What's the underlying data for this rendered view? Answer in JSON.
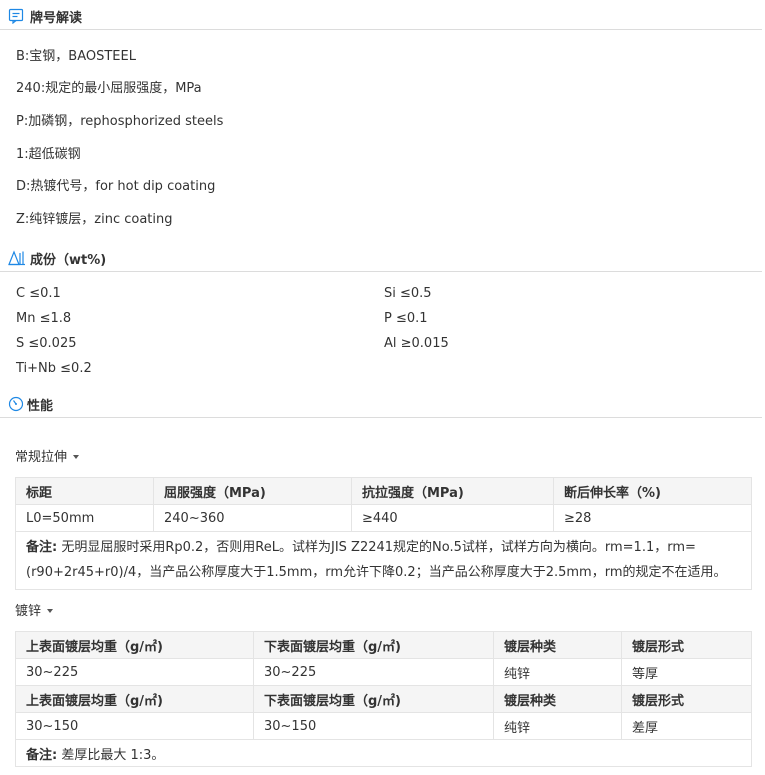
{
  "grade": {
    "title": "牌号解读",
    "lines": [
      "B:宝钢，BAOSTEEL",
      "240:规定的最小屈服强度，MPa",
      "P:加磷钢，rephosphorized steels",
      "1:超低碳钢",
      "D:热镀代号，for hot dip coating",
      "Z:纯锌镀层，zinc coating"
    ]
  },
  "composition": {
    "title": "成份（wt%)",
    "left": [
      "C ≤0.1",
      "Mn ≤1.8",
      "S ≤0.025",
      "Ti+Nb ≤0.2"
    ],
    "right": [
      "Si ≤0.5",
      "P ≤0.1",
      "Al ≥0.015"
    ]
  },
  "properties": {
    "title": "性能",
    "tensile": {
      "label": "常规拉伸",
      "headers": [
        "标距",
        "屈服强度（MPa)",
        "抗拉强度（MPa)",
        "断后伸长率（%)"
      ],
      "row": [
        "L0=50mm",
        "240~360",
        "≥440",
        "≥28"
      ],
      "note_label": "备注:",
      "note_text": "无明显屈服时采用Rp0.2，否则用ReL。试样为JIS Z2241规定的No.5试样，试样方向为横向。rm=1.1，rm=(r90+2r45+r0)/4，当产品公称厚度大于1.5mm，rm允许下降0.2；当产品公称厚度大于2.5mm，rm的规定不在适用。"
    },
    "coating": {
      "label": "镀锌",
      "headers": [
        "上表面镀层均重（g/㎡)",
        "下表面镀层均重（g/㎡)",
        "镀层种类",
        "镀层形式"
      ],
      "row1": [
        "30~225",
        "30~225",
        "纯锌",
        "等厚"
      ],
      "row2": [
        "30~150",
        "30~150",
        "纯锌",
        "差厚"
      ],
      "note_label": "备注:",
      "note_text": "差厚比最大 1:3。"
    }
  },
  "colors": {
    "accent": "#1e88e5",
    "header_bg": "#f5f5f5",
    "border": "#e4e4e4"
  }
}
